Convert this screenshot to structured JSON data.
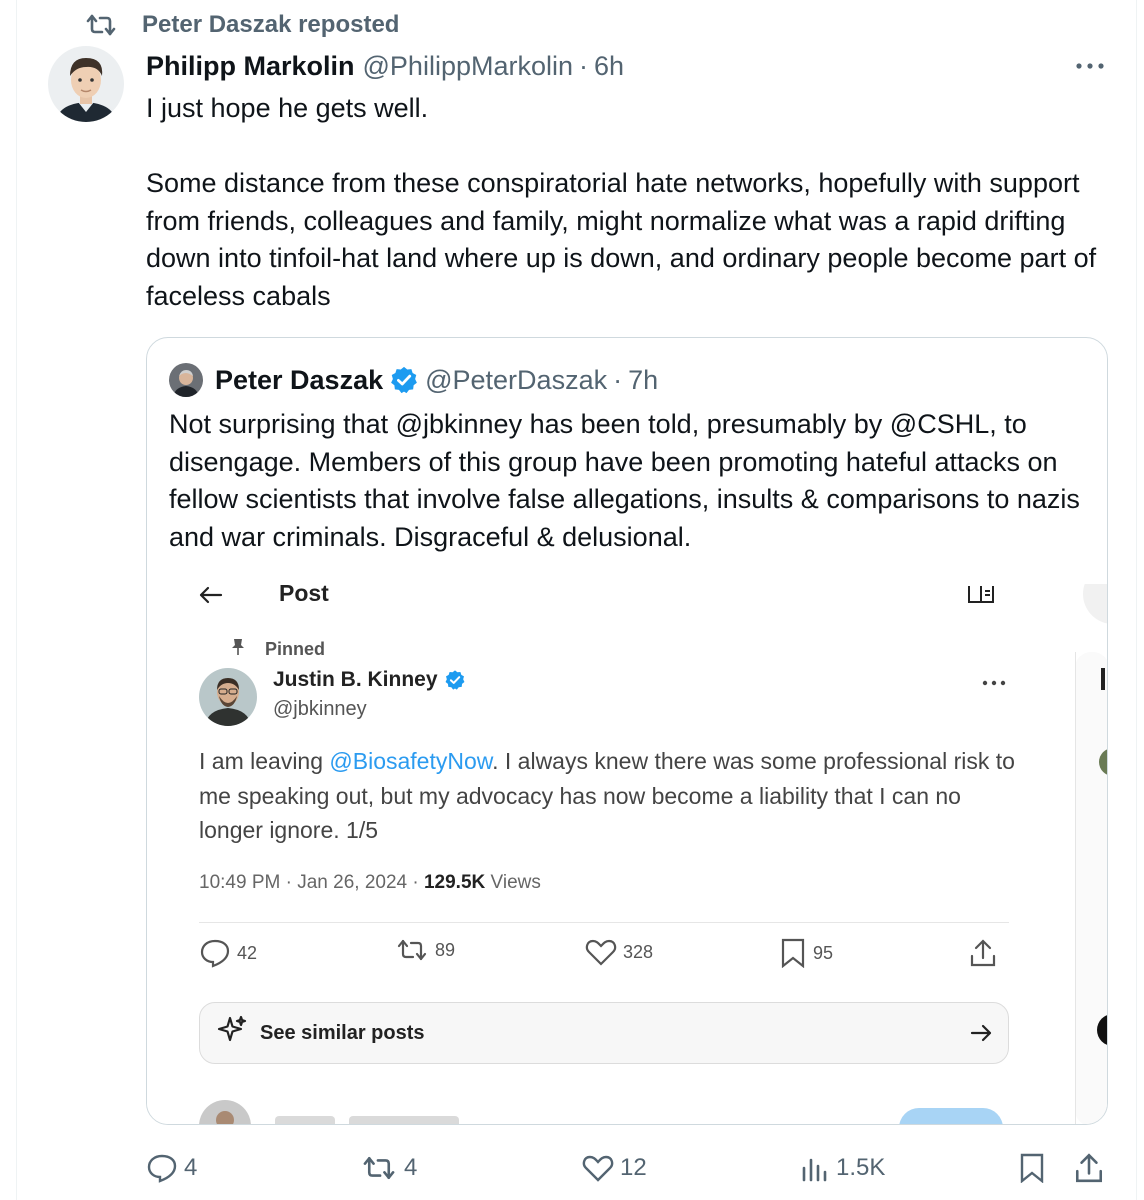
{
  "repost_banner": {
    "text": "Peter Daszak reposted"
  },
  "tweet": {
    "author_name": "Philipp Markolin",
    "author_handle": "@PhilippMarkolin",
    "time": "6h",
    "paragraphs": [
      "I just hope he gets well.",
      "Some distance from these conspiratorial hate networks, hopefully with support from friends, colleagues and family, might normalize what was a rapid drifting down into  tinfoil-hat land where up is down, and ordinary people become part of faceless cabals"
    ],
    "counts": {
      "replies": "4",
      "reposts": "4",
      "likes": "12",
      "views": "1.5K"
    }
  },
  "quote": {
    "author_name": "Peter Daszak",
    "author_handle": "@PeterDaszak",
    "time": "7h",
    "text": "Not surprising that @jbkinney has been told, presumably by @CSHL, to disengage.  Members of this group have been promoting hateful attacks on fellow scientists that involve false allegations, insults & comparisons to nazis and war criminals. Disgraceful & delusional."
  },
  "screenshot": {
    "header_title": "Post",
    "pinned_label": "Pinned",
    "author_name": "Justin B. Kinney",
    "author_handle": "@jbkinney",
    "text_before": "I am leaving ",
    "mention": "@BiosafetyNow",
    "text_after": ". I always knew there was some professional risk to me speaking out, but my advocacy has now become a liability that I can no longer ignore. 1/5",
    "time": "10:49 PM · Jan 26, 2024 · ",
    "views_count": "129.5K",
    "views_label": " Views",
    "counts": {
      "replies": "42",
      "reposts": "89",
      "likes": "328",
      "bookmarks": "95"
    },
    "similar_label": "See similar posts"
  },
  "colors": {
    "accent": "#1d9bf0",
    "secondary_text": "#536471",
    "border": "#cfd9de"
  }
}
